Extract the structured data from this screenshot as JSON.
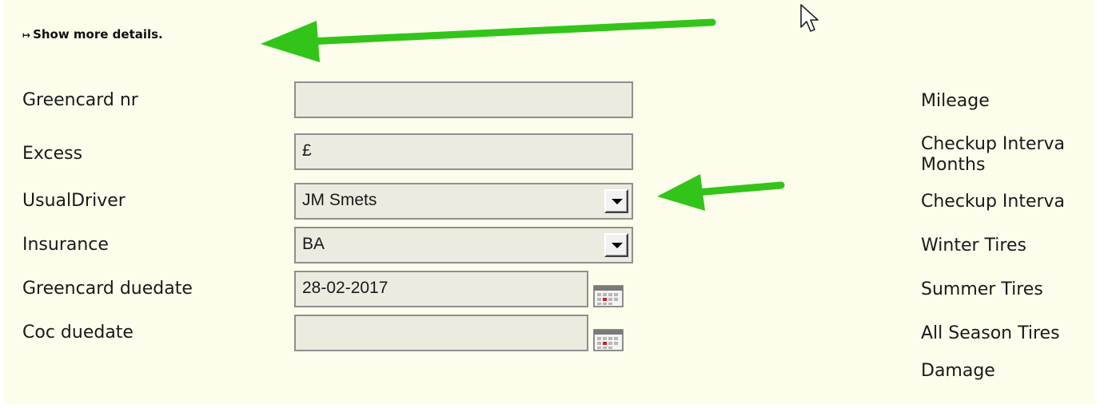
{
  "toggle": {
    "glyph": "↦",
    "label": "Show more details."
  },
  "left_fields": {
    "greencard_nr": {
      "label": "Greencard nr",
      "value": ""
    },
    "excess": {
      "label": "Excess",
      "value": "£"
    },
    "usual_driver": {
      "label": "UsualDriver",
      "value": "JM Smets"
    },
    "insurance": {
      "label": "Insurance",
      "value": "BA"
    },
    "greencard_duedate": {
      "label": "Greencard duedate",
      "value": "28-02-2017"
    },
    "coc_duedate": {
      "label": "Coc duedate",
      "value": ""
    }
  },
  "right_labels": {
    "mileage": "Mileage",
    "checkup_interval_months_line1": "Checkup Interva",
    "checkup_interval_months_line2": "Months",
    "checkup_interval": "Checkup Interva",
    "winter_tires": "Winter Tires",
    "summer_tires": "Summer Tires",
    "all_season_tires": "All Season Tires",
    "damage": "Damage"
  },
  "colors": {
    "panel_background": "#fdfdec",
    "field_background": "#ecebdf",
    "annotation_arrow": "#33c41a"
  },
  "icons": {
    "calendar": "calendar-icon",
    "dropdown": "chevron-down-icon",
    "cursor": "mouse-pointer-icon"
  }
}
